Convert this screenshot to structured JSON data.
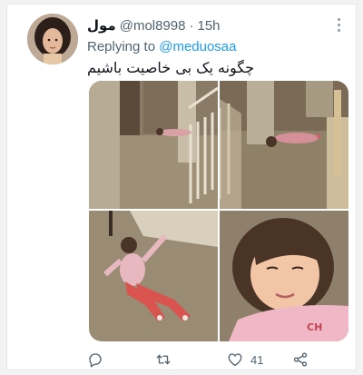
{
  "tweet": {
    "display_name": "مول",
    "handle": "@mol8998",
    "separator": "·",
    "time": "15h",
    "replying_to_label": "Replying to",
    "replying_to_handle": "@meduosaa",
    "text": "چگونه یک بی خاصیت باشیم",
    "media_count": 4
  },
  "actions": {
    "reply": {
      "icon": "reply-icon",
      "count": ""
    },
    "retweet": {
      "icon": "retweet-icon",
      "count": ""
    },
    "like": {
      "icon": "heart-icon",
      "count": "41"
    },
    "share": {
      "icon": "share-icon"
    }
  },
  "colors": {
    "link": "#1d9bf0",
    "secondary_text": "#536471",
    "primary_text": "#0f1419"
  }
}
